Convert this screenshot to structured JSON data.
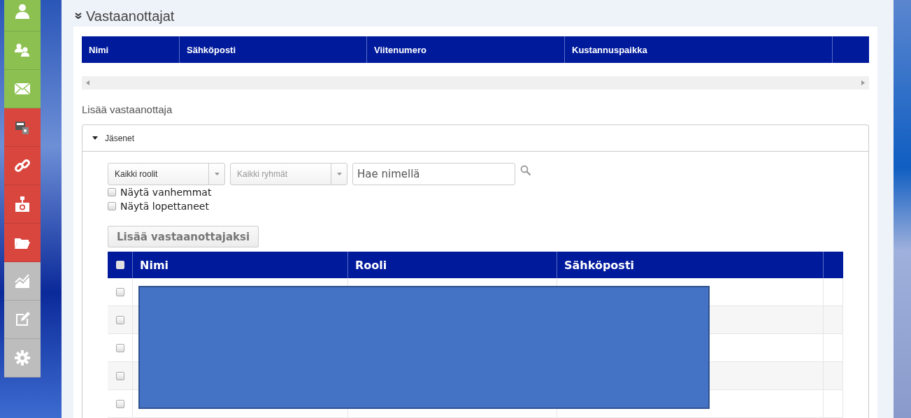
{
  "sidebar": {
    "items": [
      {
        "color": "#8cc152",
        "selected": false
      },
      {
        "color": "#8cc152",
        "selected": false
      },
      {
        "color": "#8cc152",
        "selected": false
      },
      {
        "color": "#d9463e",
        "selected": false
      },
      {
        "color": "#d9463e",
        "selected": false
      },
      {
        "color": "#d9463e",
        "selected": false
      },
      {
        "color": "#d9463e",
        "selected": false
      },
      {
        "color": "#bdbdbd",
        "selected": false
      },
      {
        "color": "#bdbdbd",
        "selected": false
      },
      {
        "color": "#bdbdbd",
        "selected": false
      }
    ]
  },
  "section": {
    "title": "Vastaanottajat",
    "expanded": true,
    "recipients_table": {
      "columns": [
        "Nimi",
        "Sähköposti",
        "Viitenumero",
        "Kustannuspaikka"
      ]
    }
  },
  "add_recipient": {
    "title": "Lisää vastaanottaja",
    "members_panel": {
      "title": "Jäsenet",
      "expanded": true,
      "role_select": {
        "value": "Kaikki roolit"
      },
      "group_select": {
        "placeholder": "Kaikki ryhmät"
      },
      "search": {
        "placeholder": "Hae nimellä"
      },
      "options": [
        {
          "label": "Näytä vanhemmat",
          "checked": false
        },
        {
          "label": "Näytä lopettaneet",
          "checked": false
        }
      ],
      "add_button": "Lisää vastaanottajaksi",
      "members_table": {
        "select_all_checked": false,
        "columns": [
          "Nimi",
          "Rooli",
          "Sähköposti"
        ],
        "rows": [
          {
            "checked": false
          },
          {
            "checked": false
          },
          {
            "checked": false
          },
          {
            "checked": false
          },
          {
            "checked": false
          }
        ]
      }
    }
  }
}
